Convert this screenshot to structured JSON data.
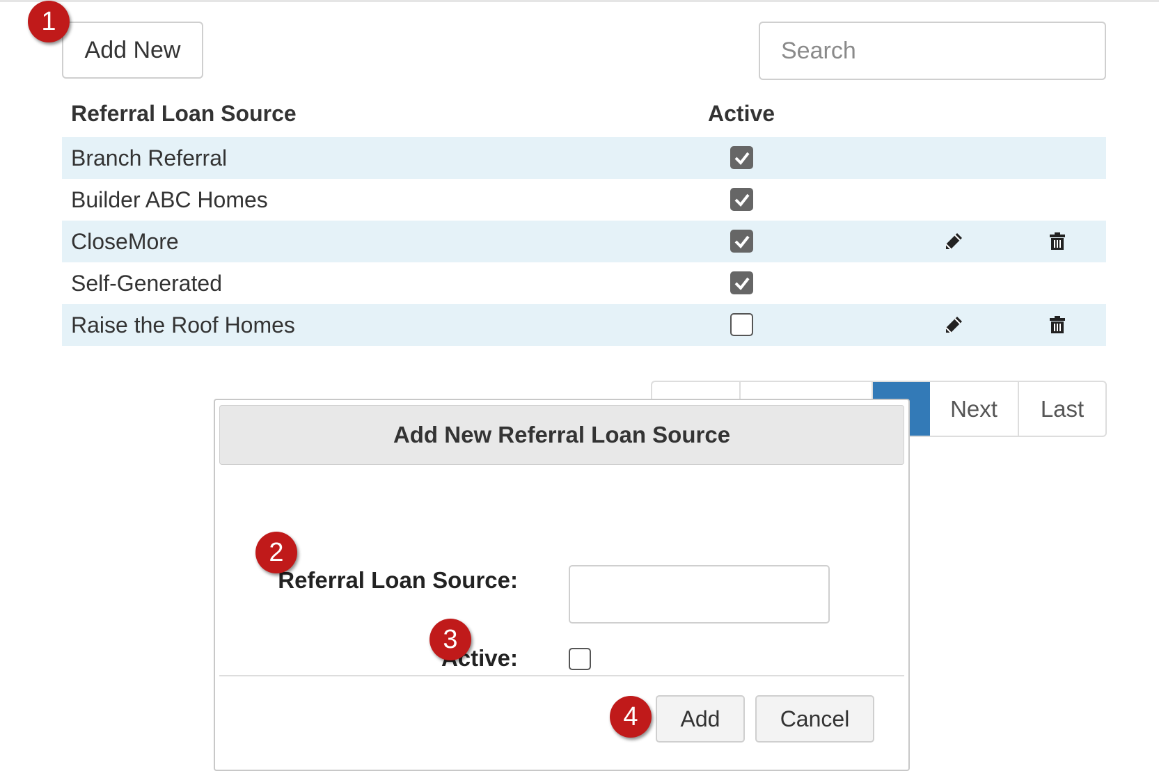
{
  "toolbar": {
    "add_new_label": "Add New",
    "search_placeholder": "Search"
  },
  "table": {
    "columns": [
      "Referral Loan Source",
      "Active"
    ],
    "rows": [
      {
        "name": "Branch Referral",
        "active": true,
        "editable": false
      },
      {
        "name": "Builder ABC Homes",
        "active": true,
        "editable": false
      },
      {
        "name": "CloseMore",
        "active": true,
        "editable": true
      },
      {
        "name": "Self-Generated",
        "active": true,
        "editable": false
      },
      {
        "name": "Raise the Roof Homes",
        "active": false,
        "editable": true
      }
    ]
  },
  "pagination": {
    "pages": [
      "",
      "",
      "",
      "Next",
      "Last"
    ],
    "current_page_index": 2,
    "active_color": "#337ab7"
  },
  "modal": {
    "title": "Add New Referral Loan Source",
    "source_label": "Referral Loan Source:",
    "source_value": "",
    "active_label": "Active:",
    "active_checked": false,
    "add_label": "Add",
    "cancel_label": "Cancel"
  },
  "markers": [
    "1",
    "2",
    "3",
    "4"
  ],
  "colors": {
    "marker": "#c01a1a",
    "striped_row": "#e5f2f8",
    "checkbox_checked": "#666666"
  },
  "icons": {
    "edit": "pencil-icon",
    "delete": "trash-icon",
    "check": "checkmark-icon"
  }
}
